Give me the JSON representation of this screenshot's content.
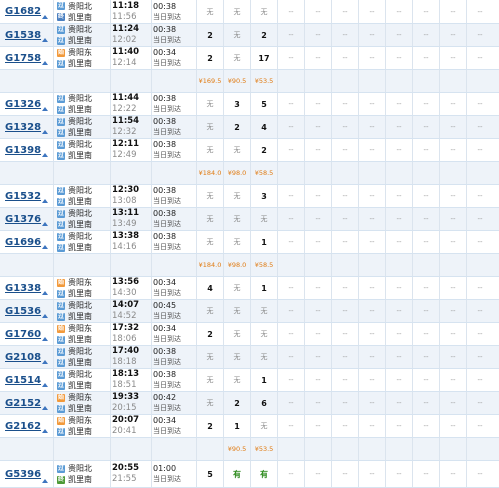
{
  "rows": [
    {
      "kind": "train",
      "h": 24,
      "alt": false,
      "train": "G1682",
      "from_icon": "过",
      "from": "贵阳北",
      "to_icon": "终",
      "to": "凯里南",
      "dep": "11:18",
      "arr": "11:56",
      "dur": "00:38",
      "note": "当日到达",
      "s1": "无",
      "s2": "无",
      "s3": "无"
    },
    {
      "kind": "train",
      "h": 23,
      "alt": true,
      "train": "G1538",
      "from_icon": "过",
      "from": "贵阳北",
      "to_icon": "过",
      "to": "凯里南",
      "dep": "11:24",
      "arr": "12:02",
      "dur": "00:38",
      "note": "当日到达",
      "s1": "2",
      "s2": "无",
      "s3": "2"
    },
    {
      "kind": "train",
      "h": 23,
      "alt": false,
      "train": "G1758",
      "from_icon": "始",
      "from": "贵阳东",
      "to_icon": "过",
      "to": "凯里南",
      "dep": "11:40",
      "arr": "12:14",
      "dur": "00:34",
      "note": "当日到达",
      "s1": "2",
      "s2": "无",
      "s3": "17"
    },
    {
      "kind": "price",
      "h": 23,
      "p1": "¥169.5",
      "p2": "¥90.5",
      "p3": "¥53.5"
    },
    {
      "kind": "train",
      "h": 23,
      "alt": false,
      "train": "G1326",
      "from_icon": "过",
      "from": "贵阳北",
      "to_icon": "过",
      "to": "凯里南",
      "dep": "11:44",
      "arr": "12:22",
      "dur": "00:38",
      "note": "当日到达",
      "s1": "无",
      "s2": "3",
      "s3": "5"
    },
    {
      "kind": "train",
      "h": 23,
      "alt": true,
      "train": "G1328",
      "from_icon": "过",
      "from": "贵阳北",
      "to_icon": "过",
      "to": "凯里南",
      "dep": "11:54",
      "arr": "12:32",
      "dur": "00:38",
      "note": "当日到达",
      "s1": "无",
      "s2": "2",
      "s3": "4"
    },
    {
      "kind": "train",
      "h": 23,
      "alt": false,
      "train": "G1398",
      "from_icon": "过",
      "from": "贵阳北",
      "to_icon": "过",
      "to": "凯里南",
      "dep": "12:11",
      "arr": "12:49",
      "dur": "00:38",
      "note": "当日到达",
      "s1": "无",
      "s2": "无",
      "s3": "2"
    },
    {
      "kind": "price",
      "h": 23,
      "p1": "¥184.0",
      "p2": "¥98.0",
      "p3": "¥58.5"
    },
    {
      "kind": "train",
      "h": 23,
      "alt": false,
      "train": "G1532",
      "from_icon": "过",
      "from": "贵阳北",
      "to_icon": "过",
      "to": "凯里南",
      "dep": "12:30",
      "arr": "13:08",
      "dur": "00:38",
      "note": "当日到达",
      "s1": "无",
      "s2": "无",
      "s3": "3"
    },
    {
      "kind": "train",
      "h": 23,
      "alt": true,
      "train": "G1376",
      "from_icon": "过",
      "from": "贵阳北",
      "to_icon": "过",
      "to": "凯里南",
      "dep": "13:11",
      "arr": "13:49",
      "dur": "00:38",
      "note": "当日到达",
      "s1": "无",
      "s2": "无",
      "s3": "无"
    },
    {
      "kind": "train",
      "h": 23,
      "alt": false,
      "train": "G1696",
      "from_icon": "过",
      "from": "贵阳北",
      "to_icon": "过",
      "to": "凯里南",
      "dep": "13:38",
      "arr": "14:16",
      "dur": "00:38",
      "note": "当日到达",
      "s1": "无",
      "s2": "无",
      "s3": "1"
    },
    {
      "kind": "price",
      "h": 23,
      "p1": "¥184.0",
      "p2": "¥98.0",
      "p3": "¥58.5"
    },
    {
      "kind": "train",
      "h": 23,
      "alt": false,
      "train": "G1338",
      "from_icon": "始",
      "from": "贵阳东",
      "to_icon": "过",
      "to": "凯里南",
      "dep": "13:56",
      "arr": "14:30",
      "dur": "00:34",
      "note": "当日到达",
      "s1": "4",
      "s2": "无",
      "s3": "1"
    },
    {
      "kind": "train",
      "h": 23,
      "alt": true,
      "train": "G1536",
      "from_icon": "过",
      "from": "贵阳北",
      "to_icon": "过",
      "to": "凯里南",
      "dep": "14:07",
      "arr": "14:52",
      "dur": "00:45",
      "note": "当日到达",
      "s1": "无",
      "s2": "无",
      "s3": "无"
    },
    {
      "kind": "train",
      "h": 23,
      "alt": false,
      "train": "G1760",
      "from_icon": "始",
      "from": "贵阳东",
      "to_icon": "过",
      "to": "凯里南",
      "dep": "17:32",
      "arr": "18:06",
      "dur": "00:34",
      "note": "当日到达",
      "s1": "2",
      "s2": "无",
      "s3": "无"
    },
    {
      "kind": "train",
      "h": 23,
      "alt": true,
      "train": "G2108",
      "from_icon": "过",
      "from": "贵阳北",
      "to_icon": "过",
      "to": "凯里南",
      "dep": "17:40",
      "arr": "18:18",
      "dur": "00:38",
      "note": "当日到达",
      "s1": "无",
      "s2": "无",
      "s3": "无"
    },
    {
      "kind": "train",
      "h": 23,
      "alt": false,
      "train": "G1514",
      "from_icon": "过",
      "from": "贵阳北",
      "to_icon": "过",
      "to": "凯里南",
      "dep": "18:13",
      "arr": "18:51",
      "dur": "00:38",
      "note": "当日到达",
      "s1": "无",
      "s2": "无",
      "s3": "1"
    },
    {
      "kind": "train",
      "h": 23,
      "alt": true,
      "train": "G2152",
      "from_icon": "始",
      "from": "贵阳东",
      "to_icon": "过",
      "to": "凯里南",
      "dep": "19:33",
      "arr": "20:15",
      "dur": "00:42",
      "note": "当日到达",
      "s1": "无",
      "s2": "2",
      "s3": "6"
    },
    {
      "kind": "train",
      "h": 23,
      "alt": false,
      "train": "G2162",
      "from_icon": "始",
      "from": "贵阳东",
      "to_icon": "过",
      "to": "凯里南",
      "dep": "20:07",
      "arr": "20:41",
      "dur": "00:34",
      "note": "当日到达",
      "s1": "2",
      "s2": "1",
      "s3": "无"
    },
    {
      "kind": "price",
      "h": 23,
      "p1": "",
      "p2": "¥90.5",
      "p3": "¥53.5"
    },
    {
      "kind": "train",
      "h": 27,
      "alt": false,
      "train": "G5396",
      "from_icon": "过",
      "from": "贵阳北",
      "to_icon": "终",
      "to": "凯里南",
      "dep": "20:55",
      "arr": "21:55",
      "dur": "01:00",
      "note": "当日到达",
      "s1": "5",
      "s2": "有",
      "s3": "有"
    }
  ],
  "dash": "--",
  "colors": {
    "link": "#1a4f8b",
    "have": "#2c8a1c",
    "price": "#e07a10",
    "row_alt": "#eef3f9"
  }
}
